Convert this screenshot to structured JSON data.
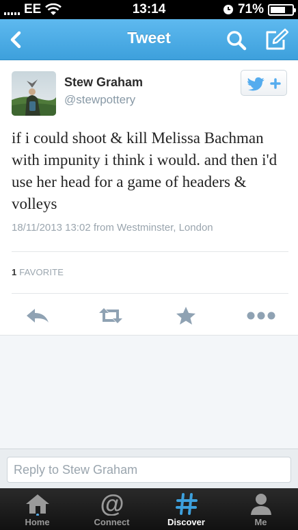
{
  "status_bar": {
    "carrier": "EE",
    "time": "13:14",
    "battery_percent": "71%",
    "battery_level": 0.71
  },
  "nav": {
    "title": "Tweet",
    "back_icon": "chevron-left-icon",
    "search_icon": "search-icon",
    "compose_icon": "compose-icon"
  },
  "tweet": {
    "author_name": "Stew Graham",
    "author_handle": "@stewpottery",
    "text": "if i could shoot & kill Melissa Bachman with impunity i think i would. and then i'd use her head for a game of headers & volleys",
    "meta": "18/11/2013 13:02 from Westminster, London",
    "favorite_count": "1",
    "favorite_label": "FAVORITE"
  },
  "reply": {
    "placeholder": "Reply to Stew Graham"
  },
  "tabs": [
    {
      "label": "Home",
      "icon": "home-icon"
    },
    {
      "label": "Connect",
      "icon": "at-icon"
    },
    {
      "label": "Discover",
      "icon": "hashtag-icon"
    },
    {
      "label": "Me",
      "icon": "person-icon"
    }
  ],
  "active_tab": "Discover",
  "colors": {
    "accent": "#3da0dc",
    "link": "#55acee",
    "action_icon": "#8fa2b3"
  }
}
